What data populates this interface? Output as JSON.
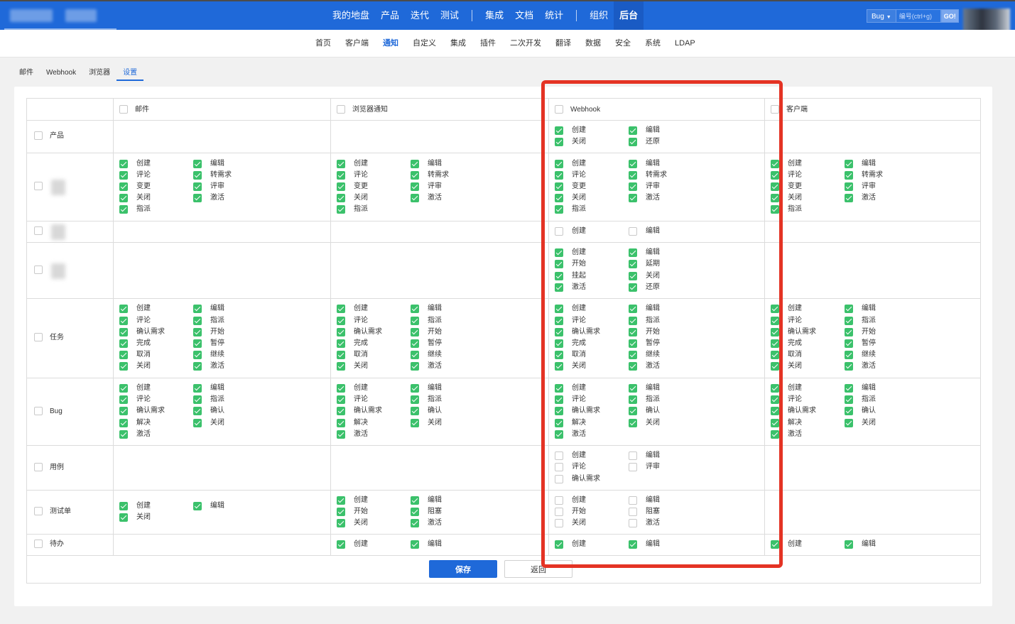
{
  "topbar": {
    "nav": [
      "我的地盘",
      "产品",
      "迭代",
      "测试",
      "|",
      "集成",
      "文档",
      "统计",
      "|",
      "组织",
      "后台"
    ],
    "active_nav": "后台",
    "search_type": "Bug",
    "search_placeholder": "编号(ctrl+g)",
    "search_go": "GO!"
  },
  "subnav": {
    "items": [
      "首页",
      "客户端",
      "通知",
      "自定义",
      "集成",
      "插件",
      "二次开发",
      "翻译",
      "数据",
      "安全",
      "系统",
      "LDAP"
    ],
    "active": "通知"
  },
  "subtabs": {
    "items": [
      "邮件",
      "Webhook",
      "浏览器",
      "设置"
    ],
    "active": "设置"
  },
  "columns": [
    {
      "key": "mail",
      "label": "邮件"
    },
    {
      "key": "browser",
      "label": "浏览器通知"
    },
    {
      "key": "webhook",
      "label": "Webhook"
    },
    {
      "key": "client",
      "label": "客户端"
    }
  ],
  "rows": [
    {
      "key": "product",
      "label": "产品",
      "cells": {
        "mail": [],
        "browser": [],
        "webhook": [
          [
            "创建",
            true
          ],
          [
            "编辑",
            true
          ],
          [
            "关闭",
            true
          ],
          [
            "还原",
            true
          ]
        ],
        "client": []
      }
    },
    {
      "key": "story",
      "label": "",
      "cells": {
        "mail": [
          [
            "创建",
            true
          ],
          [
            "编辑",
            true
          ],
          [
            "评论",
            true
          ],
          [
            "转需求",
            true
          ],
          [
            "变更",
            true
          ],
          [
            "评审",
            true
          ],
          [
            "关闭",
            true
          ],
          [
            "激活",
            true
          ],
          [
            "指派",
            true
          ]
        ],
        "browser": [
          [
            "创建",
            true
          ],
          [
            "编辑",
            true
          ],
          [
            "评论",
            true
          ],
          [
            "转需求",
            true
          ],
          [
            "变更",
            true
          ],
          [
            "评审",
            true
          ],
          [
            "关闭",
            true
          ],
          [
            "激活",
            true
          ],
          [
            "指派",
            true
          ]
        ],
        "webhook": [
          [
            "创建",
            true
          ],
          [
            "编辑",
            true
          ],
          [
            "评论",
            true
          ],
          [
            "转需求",
            true
          ],
          [
            "变更",
            true
          ],
          [
            "评审",
            true
          ],
          [
            "关闭",
            true
          ],
          [
            "激活",
            true
          ],
          [
            "指派",
            true
          ]
        ],
        "client": [
          [
            "创建",
            true
          ],
          [
            "编辑",
            true
          ],
          [
            "评论",
            true
          ],
          [
            "转需求",
            true
          ],
          [
            "变更",
            true
          ],
          [
            "评审",
            true
          ],
          [
            "关闭",
            true
          ],
          [
            "激活",
            true
          ],
          [
            "指派",
            true
          ]
        ]
      }
    },
    {
      "key": "doc",
      "label": "",
      "cells": {
        "mail": [],
        "browser": [],
        "webhook": [
          [
            "创建",
            false
          ],
          [
            "编辑",
            false
          ]
        ],
        "client": []
      }
    },
    {
      "key": "execution",
      "label": "",
      "cells": {
        "mail": [],
        "browser": [],
        "webhook": [
          [
            "创建",
            true
          ],
          [
            "编辑",
            true
          ],
          [
            "开始",
            true
          ],
          [
            "延期",
            true
          ],
          [
            "挂起",
            true
          ],
          [
            "关闭",
            true
          ],
          [
            "激活",
            true
          ],
          [
            "还原",
            true
          ]
        ],
        "client": []
      }
    },
    {
      "key": "task",
      "label": "任务",
      "cells": {
        "mail": [
          [
            "创建",
            true
          ],
          [
            "编辑",
            true
          ],
          [
            "评论",
            true
          ],
          [
            "指派",
            true
          ],
          [
            "确认需求",
            true
          ],
          [
            "开始",
            true
          ],
          [
            "完成",
            true
          ],
          [
            "暂停",
            true
          ],
          [
            "取消",
            true
          ],
          [
            "继续",
            true
          ],
          [
            "关闭",
            true
          ],
          [
            "激活",
            true
          ]
        ],
        "browser": [
          [
            "创建",
            true
          ],
          [
            "编辑",
            true
          ],
          [
            "评论",
            true
          ],
          [
            "指派",
            true
          ],
          [
            "确认需求",
            true
          ],
          [
            "开始",
            true
          ],
          [
            "完成",
            true
          ],
          [
            "暂停",
            true
          ],
          [
            "取消",
            true
          ],
          [
            "继续",
            true
          ],
          [
            "关闭",
            true
          ],
          [
            "激活",
            true
          ]
        ],
        "webhook": [
          [
            "创建",
            true
          ],
          [
            "编辑",
            true
          ],
          [
            "评论",
            true
          ],
          [
            "指派",
            true
          ],
          [
            "确认需求",
            true
          ],
          [
            "开始",
            true
          ],
          [
            "完成",
            true
          ],
          [
            "暂停",
            true
          ],
          [
            "取消",
            true
          ],
          [
            "继续",
            true
          ],
          [
            "关闭",
            true
          ],
          [
            "激活",
            true
          ]
        ],
        "client": [
          [
            "创建",
            true
          ],
          [
            "编辑",
            true
          ],
          [
            "评论",
            true
          ],
          [
            "指派",
            true
          ],
          [
            "确认需求",
            true
          ],
          [
            "开始",
            true
          ],
          [
            "完成",
            true
          ],
          [
            "暂停",
            true
          ],
          [
            "取消",
            true
          ],
          [
            "继续",
            true
          ],
          [
            "关闭",
            true
          ],
          [
            "激活",
            true
          ]
        ]
      }
    },
    {
      "key": "bug",
      "label": "Bug",
      "cells": {
        "mail": [
          [
            "创建",
            true
          ],
          [
            "编辑",
            true
          ],
          [
            "评论",
            true
          ],
          [
            "指派",
            true
          ],
          [
            "确认需求",
            true
          ],
          [
            "确认",
            true
          ],
          [
            "解决",
            true
          ],
          [
            "关闭",
            true
          ],
          [
            "激活",
            true
          ]
        ],
        "browser": [
          [
            "创建",
            true
          ],
          [
            "编辑",
            true
          ],
          [
            "评论",
            true
          ],
          [
            "指派",
            true
          ],
          [
            "确认需求",
            true
          ],
          [
            "确认",
            true
          ],
          [
            "解决",
            true
          ],
          [
            "关闭",
            true
          ],
          [
            "激活",
            true
          ]
        ],
        "webhook": [
          [
            "创建",
            true
          ],
          [
            "编辑",
            true
          ],
          [
            "评论",
            true
          ],
          [
            "指派",
            true
          ],
          [
            "确认需求",
            true
          ],
          [
            "确认",
            true
          ],
          [
            "解决",
            true
          ],
          [
            "关闭",
            true
          ],
          [
            "激活",
            true
          ]
        ],
        "client": [
          [
            "创建",
            true
          ],
          [
            "编辑",
            true
          ],
          [
            "评论",
            true
          ],
          [
            "指派",
            true
          ],
          [
            "确认需求",
            true
          ],
          [
            "确认",
            true
          ],
          [
            "解决",
            true
          ],
          [
            "关闭",
            true
          ],
          [
            "激活",
            true
          ]
        ]
      }
    },
    {
      "key": "case",
      "label": "用例",
      "cells": {
        "mail": [],
        "browser": [],
        "webhook": [
          [
            "创建",
            false
          ],
          [
            "编辑",
            false
          ],
          [
            "评论",
            false
          ],
          [
            "评审",
            false
          ],
          [
            "确认需求",
            false
          ]
        ],
        "client": []
      }
    },
    {
      "key": "testtask",
      "label": "测试单",
      "cells": {
        "mail": [
          [
            "创建",
            true
          ],
          [
            "编辑",
            true
          ],
          [
            "关闭",
            true
          ]
        ],
        "browser": [
          [
            "创建",
            true
          ],
          [
            "编辑",
            true
          ],
          [
            "开始",
            true
          ],
          [
            "阻塞",
            true
          ],
          [
            "关闭",
            true
          ],
          [
            "激活",
            true
          ]
        ],
        "webhook": [
          [
            "创建",
            false
          ],
          [
            "编辑",
            false
          ],
          [
            "开始",
            false
          ],
          [
            "阻塞",
            false
          ],
          [
            "关闭",
            false
          ],
          [
            "激活",
            false
          ]
        ],
        "client": []
      }
    },
    {
      "key": "todo",
      "label": "待办",
      "cells": {
        "mail": [],
        "browser": [
          [
            "创建",
            true
          ],
          [
            "编辑",
            true
          ]
        ],
        "webhook": [
          [
            "创建",
            true
          ],
          [
            "编辑",
            true
          ]
        ],
        "client": [
          [
            "创建",
            true
          ],
          [
            "编辑",
            true
          ]
        ]
      }
    }
  ],
  "buttons": {
    "save": "保存",
    "back": "返回"
  },
  "colors": {
    "primary": "#1f69d9",
    "checked": "#3bc16b",
    "highlight": "#e43324"
  }
}
